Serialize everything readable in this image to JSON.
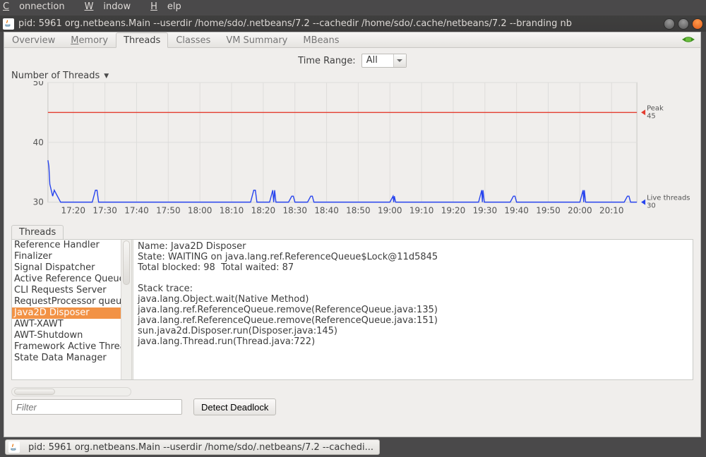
{
  "menubar": {
    "connection": "Connection",
    "window": "Window",
    "help": "Help"
  },
  "title": "pid: 5961 org.netbeans.Main --userdir /home/sdo/.netbeans/7.2 --cachedir /home/sdo/.cache/netbeans/7.2 --branding nb",
  "tabs": {
    "overview": "Overview",
    "memory": "Memory",
    "threads": "Threads",
    "classes": "Classes",
    "vmsummary": "VM Summary",
    "mbeans": "MBeans"
  },
  "time_range": {
    "label": "Time Range:",
    "selected": "All"
  },
  "chart_title": "Number of Threads",
  "peak_legend_title": "Peak",
  "peak_value": "45",
  "live_legend_title": "Live threads",
  "live_value": "30",
  "chart_data": {
    "type": "line",
    "xlabel": "",
    "ylabel": "",
    "ylim": [
      30,
      50
    ],
    "x_ticks": [
      "17:20",
      "17:30",
      "17:40",
      "17:50",
      "18:00",
      "18:10",
      "18:20",
      "18:30",
      "18:40",
      "18:50",
      "19:00",
      "19:10",
      "19:20",
      "19:30",
      "19:40",
      "19:50",
      "20:00",
      "20:10"
    ],
    "x_range": [
      0,
      186
    ],
    "series": [
      {
        "name": "Peak",
        "color": "#e33b2e",
        "x": [
          0,
          186
        ],
        "values": [
          45,
          45
        ]
      },
      {
        "name": "Live threads",
        "color": "#2744ee",
        "x": [
          0,
          0.3,
          0.6,
          1.5,
          2,
          4,
          14,
          15,
          15.5,
          16,
          16.5,
          21,
          40,
          64,
          65,
          65.5,
          66,
          70,
          71,
          71.3,
          71.6,
          72,
          76,
          77,
          77.5,
          78,
          82,
          83,
          83.5,
          84,
          92,
          94,
          108,
          109,
          109.2,
          109.4,
          109.8,
          110,
          136,
          137,
          137.2,
          137.4,
          137.8,
          138,
          146,
          147,
          147.5,
          148,
          168,
          169,
          169.2,
          169.4,
          169.8,
          170,
          182,
          183,
          183.5,
          184,
          186
        ],
        "values": [
          37,
          36,
          33,
          31,
          32,
          30,
          30,
          32,
          32,
          30,
          30,
          30,
          30,
          30,
          32,
          32,
          30,
          30,
          32,
          30,
          32,
          30,
          30,
          31,
          31,
          30,
          30,
          31,
          31,
          30,
          30,
          30,
          30,
          31,
          30,
          31,
          30,
          30,
          30,
          32,
          30,
          32,
          30,
          30,
          30,
          31,
          31,
          30,
          30,
          32,
          30,
          32,
          30,
          30,
          30,
          31,
          31,
          30,
          30
        ]
      }
    ]
  },
  "threads_subtab": "Threads",
  "thread_list": [
    "Reference Handler",
    "Finalizer",
    "Signal Dispatcher",
    "Active Reference Queue Daemon",
    "CLI Requests Server",
    "RequestProcessor queue manager",
    "Java2D Disposer",
    "AWT-XAWT",
    "AWT-Shutdown",
    "Framework Active Thread",
    "State Data Manager"
  ],
  "selected_thread_index": 6,
  "detail": {
    "name_label": "Name: ",
    "name": "Java2D Disposer",
    "state_label": "State: ",
    "state": "WAITING on java.lang.ref.ReferenceQueue$Lock@11d5845",
    "blocked_label": "Total blocked: ",
    "blocked": "98",
    "waited_label": "  Total waited: ",
    "waited": "87",
    "stack_label": "Stack trace: ",
    "stack": [
      "java.lang.Object.wait(Native Method)",
      "java.lang.ref.ReferenceQueue.remove(ReferenceQueue.java:135)",
      "java.lang.ref.ReferenceQueue.remove(ReferenceQueue.java:151)",
      "sun.java2d.Disposer.run(Disposer.java:145)",
      "java.lang.Thread.run(Thread.java:722)"
    ]
  },
  "filter_placeholder": "Filter",
  "detect_deadlock": "Detect Deadlock",
  "status_chip": "pid: 5961 org.netbeans.Main --userdir /home/sdo/.netbeans/7.2 --cachedi..."
}
